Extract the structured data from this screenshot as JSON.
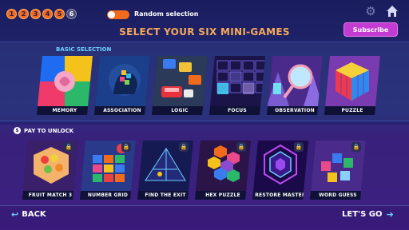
{
  "topbar": {
    "steps": [
      "1",
      "2",
      "3",
      "4",
      "5",
      "6"
    ],
    "random_label": "Random selection",
    "settings_icon": "gear-icon",
    "home_icon": "home-icon"
  },
  "title": "SELECT YOUR SIX MINI-GAMES",
  "subscribe_label": "Subscribe",
  "basic": {
    "label": "BASIC SELECTION",
    "cards": [
      "MEMORY",
      "ASSOCIATION",
      "LOGIC",
      "FOCUS",
      "OBSERVATION",
      "PUZZLE"
    ]
  },
  "pay": {
    "label": "PAY TO UNLOCK",
    "cards": [
      "FRUIT MATCH 3",
      "NUMBER GRID",
      "FIND THE EXIT",
      "HEX PUZZLE",
      "RESTORE MASTER",
      "WORD GUESS"
    ]
  },
  "nav": {
    "back_label": "BACK",
    "go_label": "LET'S GO"
  },
  "colors": {
    "accent_orange": "#f26a1b",
    "title_orange": "#f7a95a",
    "subscribe_pink": "#c43bd3",
    "section_blue": "#6cd0ff"
  }
}
